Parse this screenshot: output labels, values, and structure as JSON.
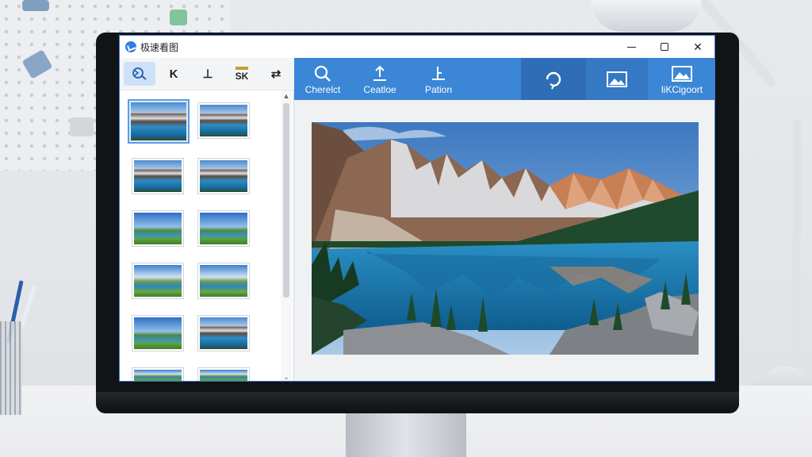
{
  "window": {
    "title": "极速看图",
    "controls": {
      "minimize": "minimize",
      "maximize": "maximize",
      "close": "✕"
    }
  },
  "left_toolbar": {
    "buttons": [
      {
        "icon": "rotate-select-icon",
        "label": "",
        "active": true
      },
      {
        "icon": "k-tool-icon",
        "label": "K"
      },
      {
        "icon": "sort-icon",
        "label": "⊥"
      },
      {
        "icon": "aspect-icon",
        "label": "SK"
      },
      {
        "icon": "swap-icon",
        "label": "⇄"
      }
    ]
  },
  "ribbon": {
    "buttons": [
      {
        "icon": "search-icon",
        "label": "Cherelct"
      },
      {
        "icon": "upload-icon",
        "label": "Ceatloe"
      },
      {
        "icon": "position-icon",
        "label": "Pation"
      },
      {
        "icon": "rotate-icon",
        "label": ""
      },
      {
        "icon": "image-icon",
        "label": ""
      },
      {
        "icon": "image-export-icon",
        "label": "liKCigoort"
      }
    ]
  },
  "thumbnails": {
    "scroll_up": "▲",
    "scroll_down": "⌄",
    "items": [
      {
        "scene": "mountain-lake",
        "selected": true
      },
      {
        "scene": "mountain-lake"
      },
      {
        "scene": "mountain-lake"
      },
      {
        "scene": "mountain-lake"
      },
      {
        "scene": "meadow-river"
      },
      {
        "scene": "meadow-river"
      },
      {
        "scene": "meadow-lake"
      },
      {
        "scene": "meadow-lake"
      },
      {
        "scene": "meadow-river"
      },
      {
        "scene": "mountain-lake"
      },
      {
        "scene": "meadow-lake"
      },
      {
        "scene": "meadow-lake"
      }
    ]
  },
  "viewer": {
    "image": "mountain lake with pine forest"
  },
  "colors": {
    "accent": "#3b86d6",
    "accent_dark": "#2f6db6",
    "selection": "#5a9de6"
  }
}
